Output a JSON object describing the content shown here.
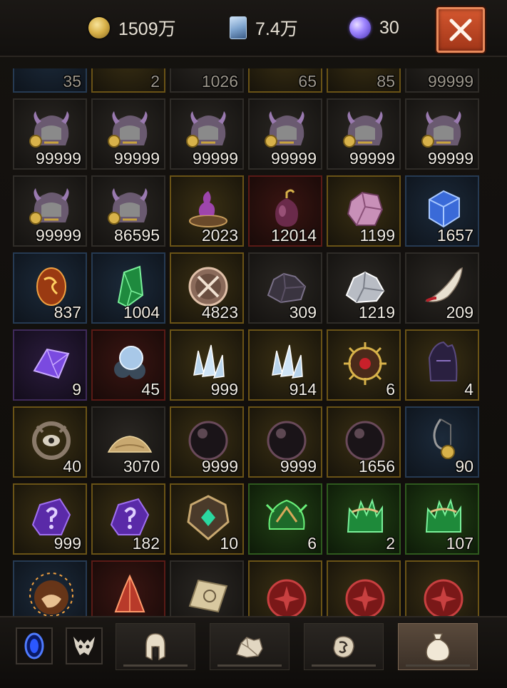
{
  "topbar": {
    "gold": "1509万",
    "cards": "7.4万",
    "orbs": "30",
    "icons": {
      "gold": "gold-coin-icon",
      "cards": "rune-card-icon",
      "orbs": "purple-orb-icon",
      "close": "close-icon"
    }
  },
  "inventory": {
    "rows": [
      {
        "faded": true,
        "items": [
          {
            "qty": "35",
            "icon": "blue-item-icon",
            "rarity": "blue"
          },
          {
            "qty": "2",
            "icon": "gold-item-icon",
            "rarity": "gold"
          },
          {
            "qty": "1026",
            "icon": "grey-item-icon",
            "rarity": "grey"
          },
          {
            "qty": "65",
            "icon": "gold-item-icon",
            "rarity": "gold"
          },
          {
            "qty": "85",
            "icon": "gold-item-icon",
            "rarity": "gold"
          },
          {
            "qty": "99999",
            "icon": "grey-item-icon",
            "rarity": "grey"
          }
        ]
      },
      {
        "faded": false,
        "items": [
          {
            "qty": "99999",
            "icon": "horned-helm-icon",
            "rarity": "grey"
          },
          {
            "qty": "99999",
            "icon": "horned-helm-icon",
            "rarity": "grey"
          },
          {
            "qty": "99999",
            "icon": "horned-helm-icon",
            "rarity": "grey"
          },
          {
            "qty": "99999",
            "icon": "horned-helm-icon",
            "rarity": "grey"
          },
          {
            "qty": "99999",
            "icon": "horned-helm-icon",
            "rarity": "grey"
          },
          {
            "qty": "99999",
            "icon": "horned-helm-icon",
            "rarity": "grey"
          }
        ]
      },
      {
        "faded": false,
        "items": [
          {
            "qty": "99999",
            "icon": "horned-helm-icon",
            "rarity": "grey"
          },
          {
            "qty": "86595",
            "icon": "horned-helm-icon",
            "rarity": "grey"
          },
          {
            "qty": "2023",
            "icon": "purple-smoke-bowl-icon",
            "rarity": "gold"
          },
          {
            "qty": "12014",
            "icon": "pouch-ornament-icon",
            "rarity": "red"
          },
          {
            "qty": "1199",
            "icon": "pink-stone-icon",
            "rarity": "gold"
          },
          {
            "qty": "1657",
            "icon": "blue-crystal-cube-icon",
            "rarity": "blue"
          }
        ]
      },
      {
        "faded": false,
        "items": [
          {
            "qty": "837",
            "icon": "fire-egg-icon",
            "rarity": "blue"
          },
          {
            "qty": "1004",
            "icon": "green-crystal-icon",
            "rarity": "blue"
          },
          {
            "qty": "4823",
            "icon": "crossed-swords-medallion-icon",
            "rarity": "gold"
          },
          {
            "qty": "309",
            "icon": "dark-ore-icon",
            "rarity": "grey"
          },
          {
            "qty": "1219",
            "icon": "silver-ore-icon",
            "rarity": "grey"
          },
          {
            "qty": "209",
            "icon": "bloody-fang-icon",
            "rarity": "grey"
          }
        ]
      },
      {
        "faded": false,
        "items": [
          {
            "qty": "9",
            "icon": "purple-crystal-icon",
            "rarity": "purple"
          },
          {
            "qty": "45",
            "icon": "pearl-cluster-icon",
            "rarity": "red"
          },
          {
            "qty": "999",
            "icon": "ice-shards-icon",
            "rarity": "gold"
          },
          {
            "qty": "914",
            "icon": "ice-shards-icon",
            "rarity": "gold"
          },
          {
            "qty": "6",
            "icon": "spiked-sigil-icon",
            "rarity": "gold"
          },
          {
            "qty": "4",
            "icon": "shadow-helm-icon",
            "rarity": "gold"
          }
        ]
      },
      {
        "faded": false,
        "items": [
          {
            "qty": "40",
            "icon": "eye-amulet-icon",
            "rarity": "gold"
          },
          {
            "qty": "3070",
            "icon": "sand-pile-icon",
            "rarity": "grey"
          },
          {
            "qty": "9999",
            "icon": "dark-sphere-icon",
            "rarity": "gold"
          },
          {
            "qty": "9999",
            "icon": "dark-sphere-icon",
            "rarity": "gold"
          },
          {
            "qty": "1656",
            "icon": "dark-sphere-icon",
            "rarity": "gold"
          },
          {
            "qty": "90",
            "icon": "hook-charm-icon",
            "rarity": "blue"
          }
        ]
      },
      {
        "faded": false,
        "items": [
          {
            "qty": "999",
            "icon": "mystery-purple-stone-icon",
            "rarity": "gold"
          },
          {
            "qty": "182",
            "icon": "mystery-purple-stone-icon",
            "rarity": "gold"
          },
          {
            "qty": "10",
            "icon": "emerald-sigil-icon",
            "rarity": "gold"
          },
          {
            "qty": "6",
            "icon": "green-thorn-helm-icon",
            "rarity": "green"
          },
          {
            "qty": "2",
            "icon": "green-thorn-crown-icon",
            "rarity": "green"
          },
          {
            "qty": "107",
            "icon": "green-thorn-crown-icon",
            "rarity": "green"
          }
        ]
      },
      {
        "faded": false,
        "items": [
          {
            "qty": "",
            "icon": "fire-demon-icon",
            "rarity": "blue"
          },
          {
            "qty": "",
            "icon": "red-flame-crystal-icon",
            "rarity": "red"
          },
          {
            "qty": "",
            "icon": "scroll-map-icon",
            "rarity": "grey"
          },
          {
            "qty": "",
            "icon": "red-seal-icon",
            "rarity": "gold"
          },
          {
            "qty": "",
            "icon": "red-seal-icon",
            "rarity": "gold"
          },
          {
            "qty": "",
            "icon": "red-seal-icon",
            "rarity": "gold"
          }
        ]
      }
    ]
  },
  "bottombar": {
    "buttons": [
      {
        "name": "portal-button",
        "icon": "blue-portal-icon"
      },
      {
        "name": "demon-mask-button",
        "icon": "demon-mask-icon"
      }
    ],
    "tabs": [
      {
        "name": "tab-equipment",
        "icon": "helmet-icon",
        "active": false
      },
      {
        "name": "tab-materials",
        "icon": "ore-icon",
        "active": false
      },
      {
        "name": "tab-runes",
        "icon": "rune-stone-icon",
        "active": false
      },
      {
        "name": "tab-bag",
        "icon": "pouch-icon",
        "active": true
      }
    ]
  }
}
